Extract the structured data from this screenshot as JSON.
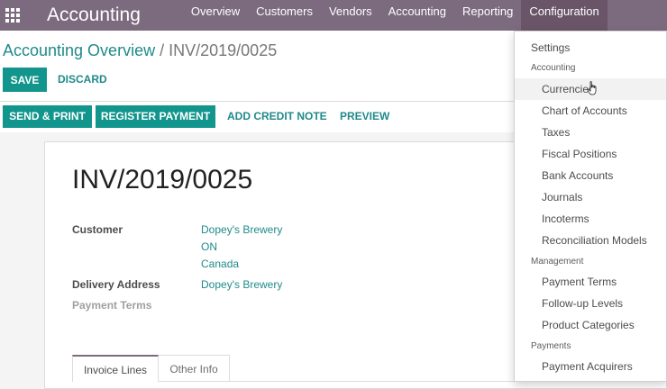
{
  "navbar": {
    "app_title": "Accounting",
    "menu": [
      {
        "label": "Overview"
      },
      {
        "label": "Customers"
      },
      {
        "label": "Vendors"
      },
      {
        "label": "Accounting"
      },
      {
        "label": "Reporting"
      },
      {
        "label": "Configuration"
      }
    ]
  },
  "breadcrumb": {
    "parent": "Accounting Overview",
    "separator": "/",
    "current": "INV/2019/0025"
  },
  "form_buttons": {
    "save": "SAVE",
    "discard": "DISCARD"
  },
  "statusbar": {
    "send_print": "SEND & PRINT",
    "register_payment": "REGISTER PAYMENT",
    "add_credit_note": "ADD CREDIT NOTE",
    "preview": "PREVIEW"
  },
  "invoice": {
    "name": "INV/2019/0025",
    "customer_label": "Customer",
    "customer_lines": [
      "Dopey's Brewery",
      "ON",
      "Canada"
    ],
    "delivery_label": "Delivery Address",
    "delivery_value": "Dopey's Brewery",
    "payment_terms_label": "Payment Terms"
  },
  "tabs": {
    "invoice_lines": "Invoice Lines",
    "other_info": "Other Info"
  },
  "config_menu": {
    "settings": "Settings",
    "accounting_header": "Accounting",
    "accounting_items": [
      "Currencies",
      "Chart of Accounts",
      "Taxes",
      "Fiscal Positions",
      "Bank Accounts",
      "Journals",
      "Incoterms",
      "Reconciliation Models"
    ],
    "management_header": "Management",
    "management_items": [
      "Payment Terms",
      "Follow-up Levels",
      "Product Categories"
    ],
    "payments_header": "Payments",
    "payments_items": [
      "Payment Acquirers"
    ],
    "hovered_item": "Currencies"
  },
  "colors": {
    "navbar": "#7c6a7e",
    "primary_button": "#12958c",
    "link": "#208a8a"
  }
}
